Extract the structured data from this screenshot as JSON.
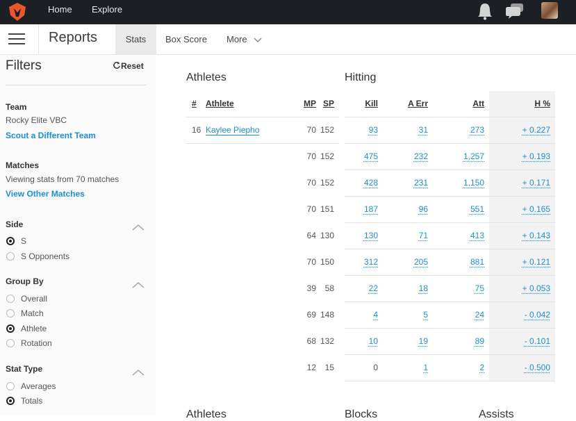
{
  "topnav": {
    "home": "Home",
    "explore": "Explore"
  },
  "header": {
    "title": "Reports",
    "tabs": [
      "Stats",
      "Box Score",
      "More"
    ],
    "active_tab": "Stats"
  },
  "filters": {
    "title": "Filters",
    "reset_label": "Reset",
    "team": {
      "label": "Team",
      "value": "Rocky Elite VBC",
      "link": "Scout a Different Team"
    },
    "matches": {
      "label": "Matches",
      "value": "Viewing stats from 70 matches",
      "link": "View Other Matches"
    },
    "side": {
      "label": "Side",
      "options": [
        "S",
        "S Opponents"
      ],
      "selected": "S"
    },
    "group_by": {
      "label": "Group By",
      "options": [
        "Overall",
        "Match",
        "Athlete",
        "Rotation"
      ],
      "selected": "Athlete"
    },
    "stat_type": {
      "label": "Stat Type",
      "options": [
        "Averages",
        "Totals"
      ],
      "selected": "Totals"
    }
  },
  "athletes_section": {
    "title": "Athletes",
    "columns": [
      "#",
      "Athlete",
      "MP",
      "SP"
    ]
  },
  "hitting_section": {
    "title": "Hitting",
    "columns": [
      "Kill",
      "A Err",
      "Att",
      "H %"
    ]
  },
  "rows": [
    {
      "num": "16",
      "athlete": "Kaylee Piepho",
      "mp": "70",
      "sp": "152",
      "kill": "93",
      "aerr": "31",
      "att": "273",
      "h": "+ 0.227"
    },
    {
      "num": "",
      "athlete": "",
      "mp": "70",
      "sp": "152",
      "kill": "475",
      "aerr": "232",
      "att": "1,257",
      "h": "+ 0.193"
    },
    {
      "num": "",
      "athlete": "",
      "mp": "70",
      "sp": "152",
      "kill": "428",
      "aerr": "231",
      "att": "1,150",
      "h": "+ 0.171"
    },
    {
      "num": "",
      "athlete": "",
      "mp": "70",
      "sp": "151",
      "kill": "187",
      "aerr": "96",
      "att": "551",
      "h": "+ 0.165"
    },
    {
      "num": "",
      "athlete": "",
      "mp": "64",
      "sp": "130",
      "kill": "130",
      "aerr": "71",
      "att": "413",
      "h": "+ 0.143"
    },
    {
      "num": "",
      "athlete": "",
      "mp": "70",
      "sp": "150",
      "kill": "312",
      "aerr": "205",
      "att": "881",
      "h": "+ 0.121"
    },
    {
      "num": "",
      "athlete": "",
      "mp": "39",
      "sp": "58",
      "kill": "22",
      "aerr": "18",
      "att": "75",
      "h": "+ 0.053"
    },
    {
      "num": "",
      "athlete": "",
      "mp": "69",
      "sp": "148",
      "kill": "4",
      "aerr": "5",
      "att": "24",
      "h": "- 0.042"
    },
    {
      "num": "",
      "athlete": "",
      "mp": "68",
      "sp": "132",
      "kill": "10",
      "aerr": "19",
      "att": "89",
      "h": "- 0.101"
    },
    {
      "num": "",
      "athlete": "",
      "mp": "12",
      "sp": "15",
      "kill": "0",
      "aerr": "1",
      "att": "2",
      "h": "- 0.500"
    }
  ],
  "bottom_sections": [
    "Athletes",
    "Blocks",
    "Assists"
  ],
  "colors": {
    "topbar": "#1c1f24",
    "accent": "#1a8fd8",
    "logo": "#e8562a"
  }
}
